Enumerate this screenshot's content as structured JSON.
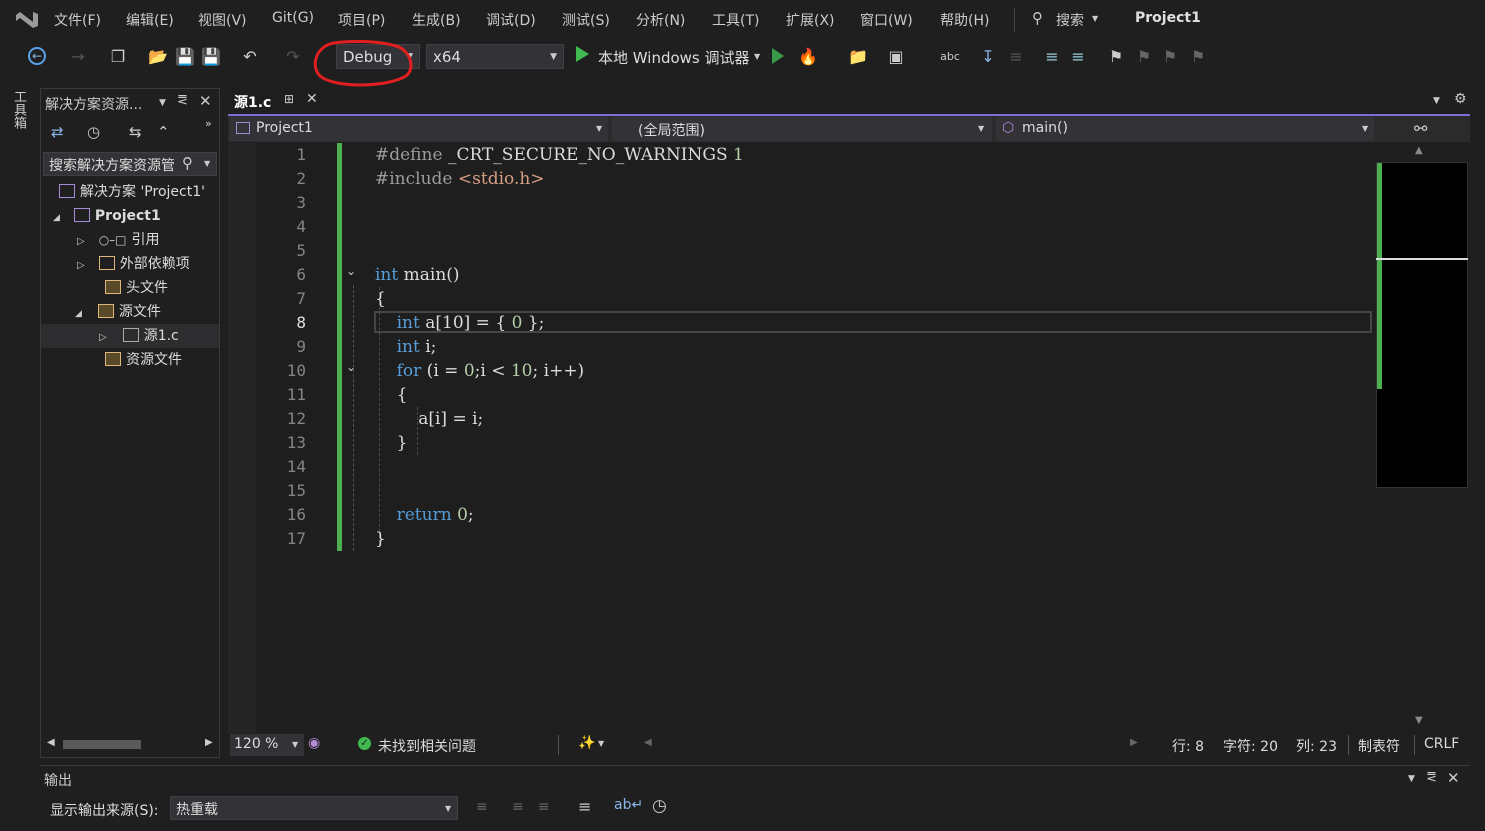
{
  "menu": {
    "items": [
      "文件(F)",
      "编辑(E)",
      "视图(V)",
      "Git(G)",
      "项目(P)",
      "生成(B)",
      "调试(D)",
      "测试(S)",
      "分析(N)",
      "工具(T)",
      "扩展(X)",
      "窗口(W)",
      "帮助(H)"
    ],
    "search_label": "搜索",
    "project_title": "Project1"
  },
  "toolbar": {
    "config": "Debug",
    "platform": "x64",
    "run_label": "本地 Windows 调试器"
  },
  "side_strip": {
    "toolbox_label": "工具箱"
  },
  "solution_explorer": {
    "title": "解决方案资源...",
    "search_placeholder": "搜索解决方案资源管",
    "tree": [
      {
        "label": "解决方案 'Project1'",
        "bold": false
      },
      {
        "label": "Project1",
        "bold": true
      },
      {
        "label": "引用",
        "bold": false
      },
      {
        "label": "外部依赖项",
        "bold": false
      },
      {
        "label": "头文件",
        "bold": false
      },
      {
        "label": "源文件",
        "bold": false
      },
      {
        "label": "源1.c",
        "bold": false
      },
      {
        "label": "资源文件",
        "bold": false
      }
    ]
  },
  "editor": {
    "tab": "源1.c",
    "nav_project": "Project1",
    "nav_scope": "(全局范围)",
    "nav_member": "main()",
    "line_numbers": [
      "1",
      "2",
      "3",
      "4",
      "5",
      "6",
      "7",
      "8",
      "9",
      "10",
      "11",
      "12",
      "13",
      "14",
      "15",
      "16",
      "17"
    ],
    "lines": [
      [
        [
          "pp",
          "#define "
        ],
        [
          "",
          "_CRT_SECURE_NO_WARNINGS "
        ],
        [
          "num",
          "1"
        ]
      ],
      [
        [
          "pp",
          "#include "
        ],
        [
          "str",
          "<stdio.h>"
        ]
      ],
      [],
      [],
      [],
      [
        [
          "kw",
          "int"
        ],
        [
          "",
          " main()"
        ]
      ],
      [
        [
          "",
          "{"
        ]
      ],
      [
        [
          "",
          "    "
        ],
        [
          "kw",
          "int"
        ],
        [
          "",
          " a[10] = { "
        ],
        [
          "num",
          "0"
        ],
        [
          "",
          " };"
        ]
      ],
      [
        [
          "",
          "    "
        ],
        [
          "kw",
          "int"
        ],
        [
          "",
          " i;"
        ]
      ],
      [
        [
          "",
          "    "
        ],
        [
          "kw",
          "for"
        ],
        [
          "",
          " (i = "
        ],
        [
          "num",
          "0"
        ],
        [
          "",
          ";i < "
        ],
        [
          "num",
          "10"
        ],
        [
          "",
          "; i++)"
        ]
      ],
      [
        [
          "",
          "    {"
        ]
      ],
      [
        [
          "",
          "        a[i] = i;"
        ]
      ],
      [
        [
          "",
          "    }"
        ]
      ],
      [],
      [],
      [
        [
          "",
          "    "
        ],
        [
          "kw",
          "return"
        ],
        [
          "",
          " "
        ],
        [
          "num",
          "0"
        ],
        [
          "",
          ";"
        ]
      ],
      [
        [
          "",
          "}"
        ]
      ]
    ]
  },
  "status": {
    "zoom": "120 %",
    "issues": "未找到相关问题",
    "line": "行: 8",
    "char": "字符: 20",
    "col": "列: 23",
    "indent": "制表符",
    "eol": "CRLF"
  },
  "output": {
    "title": "输出",
    "source_label": "显示输出来源(S):",
    "source_value": "热重载"
  },
  "colors": {
    "accent": "#7a6fd6",
    "change_bar": "#4caf50",
    "annotation": "#e02020"
  }
}
